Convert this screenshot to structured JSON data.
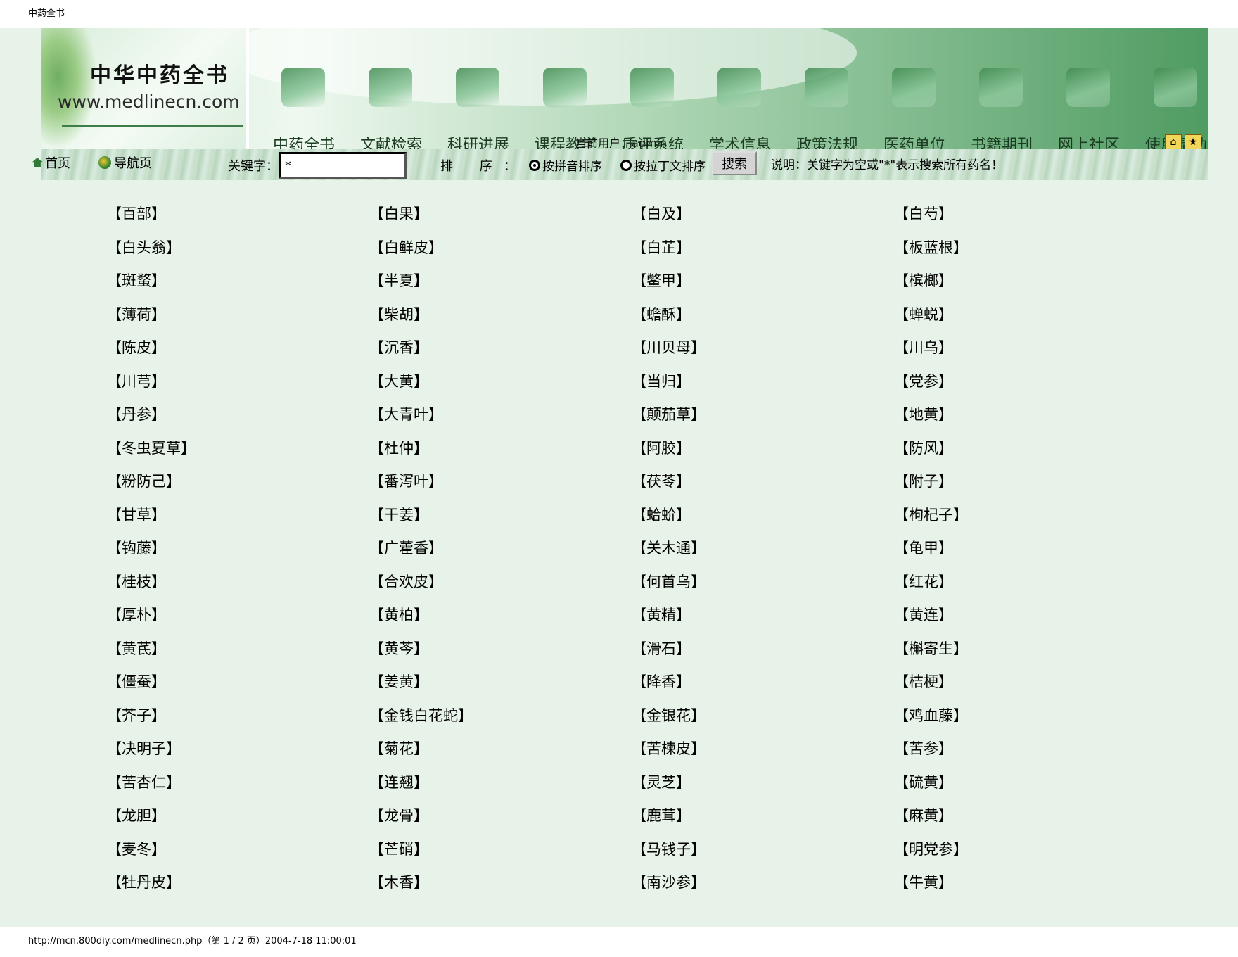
{
  "window": {
    "title": "中药全书"
  },
  "banner": {
    "logo_title": "中华中药全书",
    "logo_url": "www.medlinecn.com",
    "nav": [
      {
        "label": "中药全书",
        "icon": "book-icon"
      },
      {
        "label": "文献检索",
        "icon": "magnifier-icon"
      },
      {
        "label": "科研进展",
        "icon": "herb-icon"
      },
      {
        "label": "课程教学",
        "icon": "books-icon"
      },
      {
        "label": "质评系统",
        "icon": "molecule-icon"
      },
      {
        "label": "学术信息",
        "icon": "folder-icon"
      },
      {
        "label": "政策法规",
        "icon": "globe-icon"
      },
      {
        "label": "医药单位",
        "icon": "medical-kit-icon"
      },
      {
        "label": "书籍期刊",
        "icon": "bookshelf-icon"
      },
      {
        "label": "网上社区",
        "icon": "community-icon"
      },
      {
        "label": "使用帮助",
        "icon": "help-icon"
      }
    ],
    "current_user": "当前用户：admin"
  },
  "toolbar": {
    "home_label": "首页",
    "nav_page_label": "导航页",
    "keyword_label": "关键字：",
    "keyword_value": "*",
    "sort_label": "排 序：",
    "sort_options": [
      "按拼音排序",
      "按拉丁文排序"
    ],
    "sort_selected": 0,
    "search_button": "搜索",
    "hint": "说明：关键字为空或\"*\"表示搜索所有药名！"
  },
  "herbs": [
    "【百部】",
    "【白果】",
    "【白及】",
    "【白芍】",
    "【白头翁】",
    "【白鲜皮】",
    "【白芷】",
    "【板蓝根】",
    "【斑蝥】",
    "【半夏】",
    "【鳖甲】",
    "【槟榔】",
    "【薄荷】",
    "【柴胡】",
    "【蟾酥】",
    "【蝉蜕】",
    "【陈皮】",
    "【沉香】",
    "【川贝母】",
    "【川乌】",
    "【川芎】",
    "【大黄】",
    "【当归】",
    "【党参】",
    "【丹参】",
    "【大青叶】",
    "【颠茄草】",
    "【地黄】",
    "【冬虫夏草】",
    "【杜仲】",
    "【阿胶】",
    "【防风】",
    "【粉防己】",
    "【番泻叶】",
    "【茯苓】",
    "【附子】",
    "【甘草】",
    "【干姜】",
    "【蛤蚧】",
    "【枸杞子】",
    "【钩藤】",
    "【广藿香】",
    "【关木通】",
    "【龟甲】",
    "【桂枝】",
    "【合欢皮】",
    "【何首乌】",
    "【红花】",
    "【厚朴】",
    "【黄柏】",
    "【黄精】",
    "【黄连】",
    "【黄芪】",
    "【黄芩】",
    "【滑石】",
    "【槲寄生】",
    "【僵蚕】",
    "【姜黄】",
    "【降香】",
    "【桔梗】",
    "【芥子】",
    "【金钱白花蛇】",
    "【金银花】",
    "【鸡血藤】",
    "【决明子】",
    "【菊花】",
    "【苦楝皮】",
    "【苦参】",
    "【苦杏仁】",
    "【连翘】",
    "【灵芝】",
    "【硫黄】",
    "【龙胆】",
    "【龙骨】",
    "【鹿茸】",
    "【麻黄】",
    "【麦冬】",
    "【芒硝】",
    "【马钱子】",
    "【明党参】",
    "【牡丹皮】",
    "【木香】",
    "【南沙参】",
    "【牛黄】"
  ],
  "footer": {
    "url_line": "http://mcn.800diy.com/medlinecn.php（第 1 / 2 页）2004-7-18 11:00:01"
  }
}
